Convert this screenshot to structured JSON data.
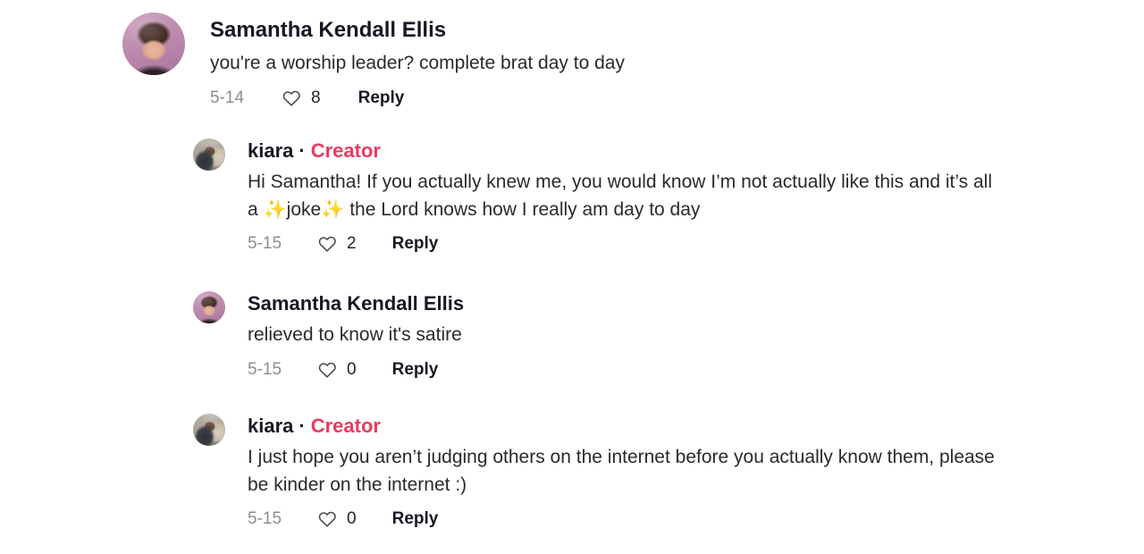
{
  "theme": {
    "background": "#ffffff",
    "text_primary": "#161823",
    "text_body": "#2a2a2e",
    "text_muted": "#8d8d91",
    "creator_accent": "#ea3a60",
    "emoji_yellow": "#f5c83b"
  },
  "icons": {
    "heart": "heart-icon"
  },
  "thread": {
    "root": {
      "author": "Samantha Kendall Ellis",
      "is_creator": false,
      "avatar_name": "samantha-avatar",
      "text": "you're a worship leader? complete brat day to day",
      "date": "5-14",
      "likes": "8",
      "reply_label": "Reply"
    },
    "replies": [
      {
        "author": "kiara",
        "is_creator": true,
        "creator_separator": "·",
        "creator_label": "Creator",
        "avatar_name": "kiara-avatar",
        "text_parts": [
          {
            "type": "text",
            "value": "Hi Samantha! If you actually knew me, you would know I’m not actually like this and it’s all a "
          },
          {
            "type": "emoji",
            "value": "✨"
          },
          {
            "type": "text",
            "value": "joke"
          },
          {
            "type": "emoji",
            "value": "✨"
          },
          {
            "type": "text",
            "value": " the Lord knows how I really am day to day"
          }
        ],
        "date": "5-15",
        "likes": "2",
        "reply_label": "Reply"
      },
      {
        "author": "Samantha Kendall Ellis",
        "is_creator": false,
        "avatar_name": "samantha-avatar",
        "text_parts": [
          {
            "type": "text",
            "value": "relieved to know it's satire"
          }
        ],
        "date": "5-15",
        "likes": "0",
        "reply_label": "Reply"
      },
      {
        "author": "kiara",
        "is_creator": true,
        "creator_separator": "·",
        "creator_label": "Creator",
        "avatar_name": "kiara-avatar",
        "text_parts": [
          {
            "type": "text",
            "value": "I just hope you aren’t judging others on the internet before you actually know them, please be kinder on the internet :)"
          }
        ],
        "date": "5-15",
        "likes": "0",
        "reply_label": "Reply"
      }
    ]
  }
}
